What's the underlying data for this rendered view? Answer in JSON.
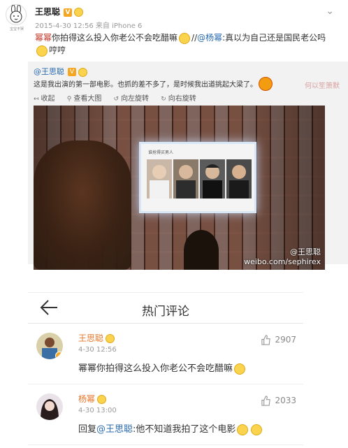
{
  "post": {
    "author": "王思聪",
    "meta": "2015-4-30 12:56 来自 iPhone 6",
    "avatar_caption": "宝宝不哭",
    "text_mention": "幂幂",
    "text_main": "你拍得这么投入你老公不会吃醋嘛",
    "text_sep": "//",
    "text_at": "@杨幂",
    "text_reply": ":真以为自己还是国民老公吗",
    "text_end": "哼哼"
  },
  "quote": {
    "author": "@王思聪",
    "text": "这是我出演的第一部电影。也抓的差不多了，是时候我出道挑起大梁了。",
    "watermark": "何以笙箫默",
    "tools": [
      {
        "icon": "收",
        "label": "收起"
      },
      {
        "icon": "看",
        "label": "查看大图"
      },
      {
        "icon": "左",
        "label": "向左旋转"
      },
      {
        "icon": "右",
        "label": "向右旋转"
      }
    ],
    "photo_watermark_name": "@王思聪",
    "photo_watermark_url": "weibo.com/sephirex",
    "screen_caption": "谁抢得买男人"
  },
  "hot": {
    "title": "热门评论",
    "comments": [
      {
        "name": "王思聪",
        "time": "4-30 12:56",
        "likes": "2907",
        "text": "幂幂你拍得这么投入你老公不会吃醋嘛"
      },
      {
        "name": "杨幂",
        "time": "4-30 13:00",
        "likes": "2033",
        "reply_prefix": "回复",
        "reply_at": "@王思聪",
        "text": ":他不知道我拍了这个电影"
      }
    ]
  },
  "colors": {
    "accent_orange": "#e8762b",
    "link_blue": "#2b6cb0",
    "mention_red": "#c0392b"
  }
}
